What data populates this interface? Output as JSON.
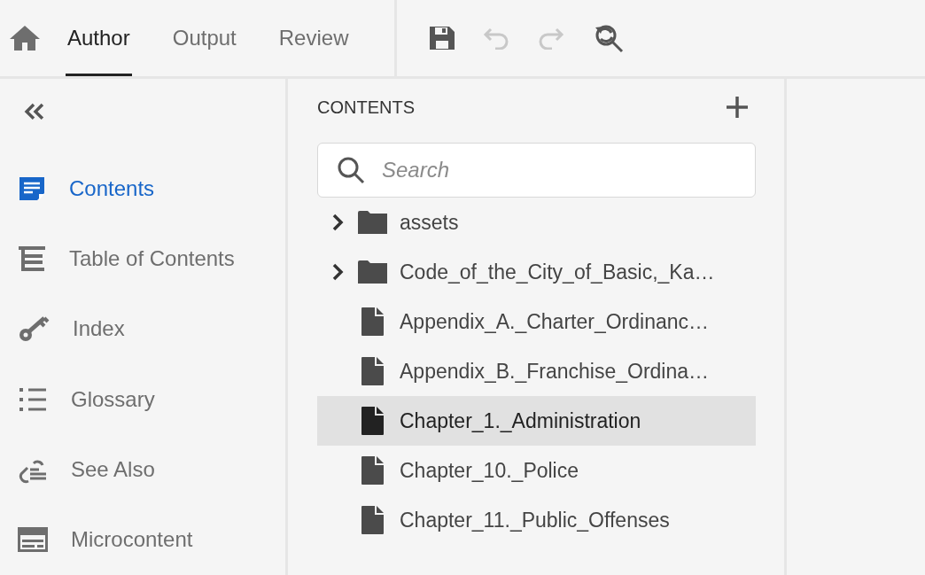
{
  "tabs": [
    {
      "label": "Author",
      "selected": true
    },
    {
      "label": "Output",
      "selected": false
    },
    {
      "label": "Review",
      "selected": false
    }
  ],
  "toolbar": [
    {
      "kind": "save",
      "disabled": false
    },
    {
      "kind": "undo",
      "disabled": true
    },
    {
      "kind": "redo",
      "disabled": true
    },
    {
      "kind": "find",
      "disabled": false
    }
  ],
  "sidebar": {
    "items": [
      {
        "kind": "contents",
        "label": "Contents",
        "selected": true
      },
      {
        "kind": "toc",
        "label": "Table of Contents",
        "selected": false
      },
      {
        "kind": "index",
        "label": "Index",
        "selected": false
      },
      {
        "kind": "glossary",
        "label": "Glossary",
        "selected": false
      },
      {
        "kind": "see-also",
        "label": "See Also",
        "selected": false
      },
      {
        "kind": "microcontent",
        "label": "Microcontent",
        "selected": false
      }
    ]
  },
  "contents": {
    "title": "CONTENTS",
    "search": {
      "placeholder": "Search"
    },
    "items": [
      {
        "kind": "folder",
        "label": "assets",
        "expanded": false,
        "selected": false
      },
      {
        "kind": "folder",
        "label": "Code_of_the_City_of_Basic,_Ka…",
        "expanded": false,
        "selected": false
      },
      {
        "kind": "file",
        "label": "Appendix_A._Charter_Ordinanc…",
        "selected": false
      },
      {
        "kind": "file",
        "label": "Appendix_B._Franchise_Ordina…",
        "selected": false
      },
      {
        "kind": "file",
        "label": "Chapter_1._Administration",
        "selected": true
      },
      {
        "kind": "file",
        "label": "Chapter_10._Police",
        "selected": false
      },
      {
        "kind": "file",
        "label": "Chapter_11._Public_Offenses",
        "selected": false
      }
    ]
  }
}
